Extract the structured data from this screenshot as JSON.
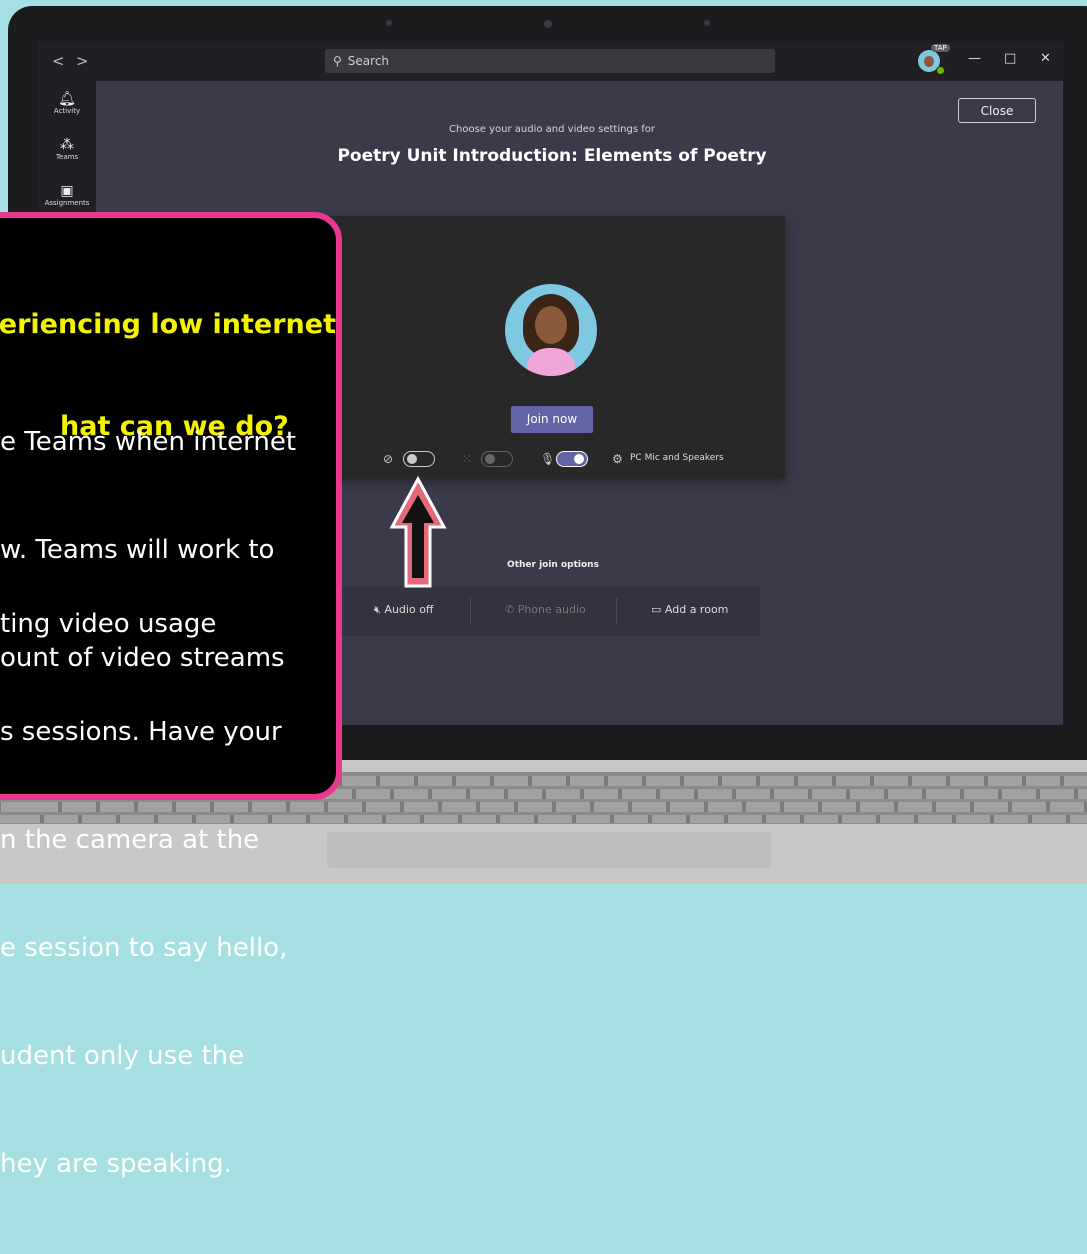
{
  "window": {
    "search_placeholder": "Search",
    "avatar_badge": "TAP",
    "nav": {
      "back": "<",
      "forward": ">"
    },
    "controls": {
      "minimize": "—",
      "maximize": "□",
      "close": "✕"
    }
  },
  "rail": {
    "items": [
      {
        "label": "Activity",
        "icon": "bell-icon"
      },
      {
        "label": "Teams",
        "icon": "teams-icon"
      },
      {
        "label": "Assignments",
        "icon": "assignments-icon"
      }
    ]
  },
  "prejoin": {
    "close_label": "Close",
    "subtitle": "Choose your audio and video settings for",
    "meeting_title": "Poetry Unit Introduction: Elements of Poetry",
    "join_label": "Join now",
    "camera_on": false,
    "blur_on": false,
    "mic_on": true,
    "device_label": "PC Mic and Speakers",
    "other_label": "Other join options",
    "options": [
      {
        "label": "Audio off",
        "icon": "audio-off-icon",
        "disabled": false
      },
      {
        "label": "Phone audio",
        "icon": "phone-icon",
        "disabled": true
      },
      {
        "label": "Add a room",
        "icon": "room-icon",
        "disabled": false
      }
    ]
  },
  "callout": {
    "question_line1": "eriencing low internet",
    "question_line2": "hat can we do?",
    "para1": [
      "e Teams when internet",
      "w. Teams will work to",
      "ount of video streams"
    ],
    "para2": [
      "ting video usage",
      "s sessions. Have your",
      "n the camera at the",
      "e session to say hello,",
      "udent only use the",
      "hey are speaking."
    ]
  },
  "colors": {
    "accent": "#6264a7",
    "callout_border": "#e8388f",
    "callout_title": "#f3f300",
    "background": "#a6e0e2",
    "arrow_fill": "#e46a7b"
  }
}
